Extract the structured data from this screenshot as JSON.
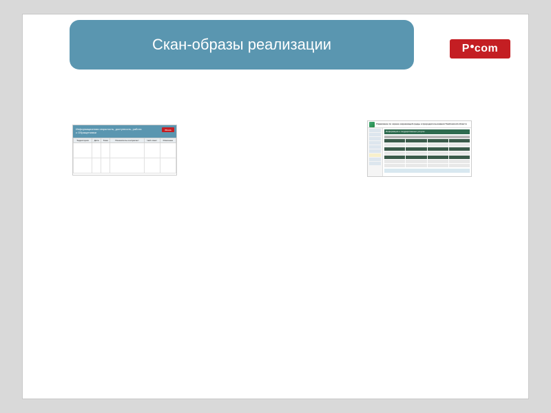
{
  "header": {
    "title": "Скан-образы реализации"
  },
  "logo": {
    "text_left": "P",
    "text_right": "com"
  },
  "thumb_left": {
    "header_text": "Информационная открытость, доступность, работа с Обращениями",
    "header_logo": "Picom",
    "cols": [
      "Территория",
      "Дата",
      "Тема",
      "Показатель контрагент",
      "Чей ответ",
      "Описание"
    ]
  },
  "thumb_right": {
    "top_text": "Управление по охране окружающей среды и природопользования Тамбовской области",
    "banner_text": "Информация о государственных услугах"
  }
}
